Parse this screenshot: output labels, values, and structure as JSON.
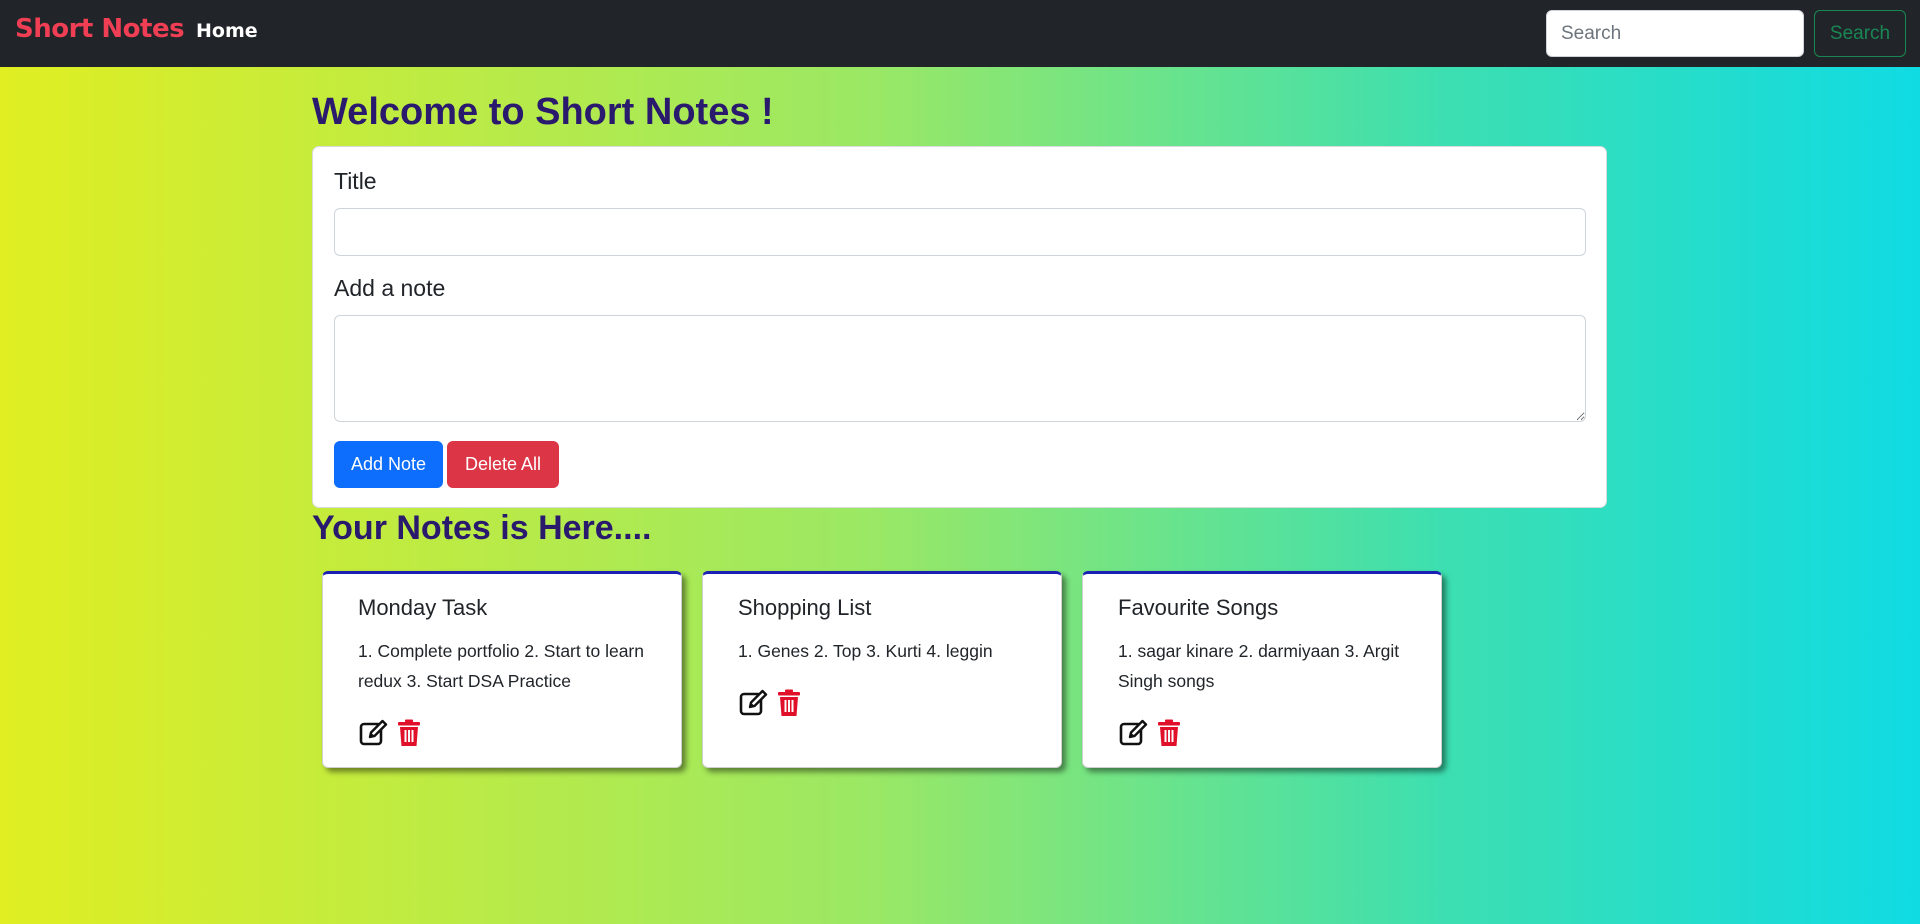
{
  "navbar": {
    "brand": "Short Notes",
    "home_link": "Home",
    "search_placeholder": "Search",
    "search_button": "Search"
  },
  "main": {
    "welcome_title": "Welcome to Short Notes !",
    "form": {
      "title_label": "Title",
      "title_value": "",
      "note_label": "Add a note",
      "note_value": "",
      "add_button": "Add Note",
      "delete_all_button": "Delete All"
    },
    "notes_heading": "Your Notes is Here....",
    "notes": [
      {
        "title": "Monday Task",
        "text": "1. Complete portfolio 2. Start to learn redux 3. Start DSA Practice",
        "edit_icon": "edit-icon",
        "delete_icon": "trash-icon"
      },
      {
        "title": "Shopping List",
        "text": "1. Genes 2. Top 3. Kurti 4. leggin",
        "edit_icon": "edit-icon",
        "delete_icon": "trash-icon"
      },
      {
        "title": "Favourite Songs",
        "text": "1. sagar kinare 2. darmiyaan 3. Argit Singh songs",
        "edit_icon": "edit-icon",
        "delete_icon": "trash-icon"
      }
    ]
  },
  "colors": {
    "navbar_bg": "#212529",
    "brand": "#f03e54",
    "heading": "#2a1a6e",
    "primary": "#0d6efd",
    "danger": "#dc3545",
    "success": "#198754",
    "trash_icon": "#e0102b",
    "card_top_border": "#1b1fb4"
  }
}
